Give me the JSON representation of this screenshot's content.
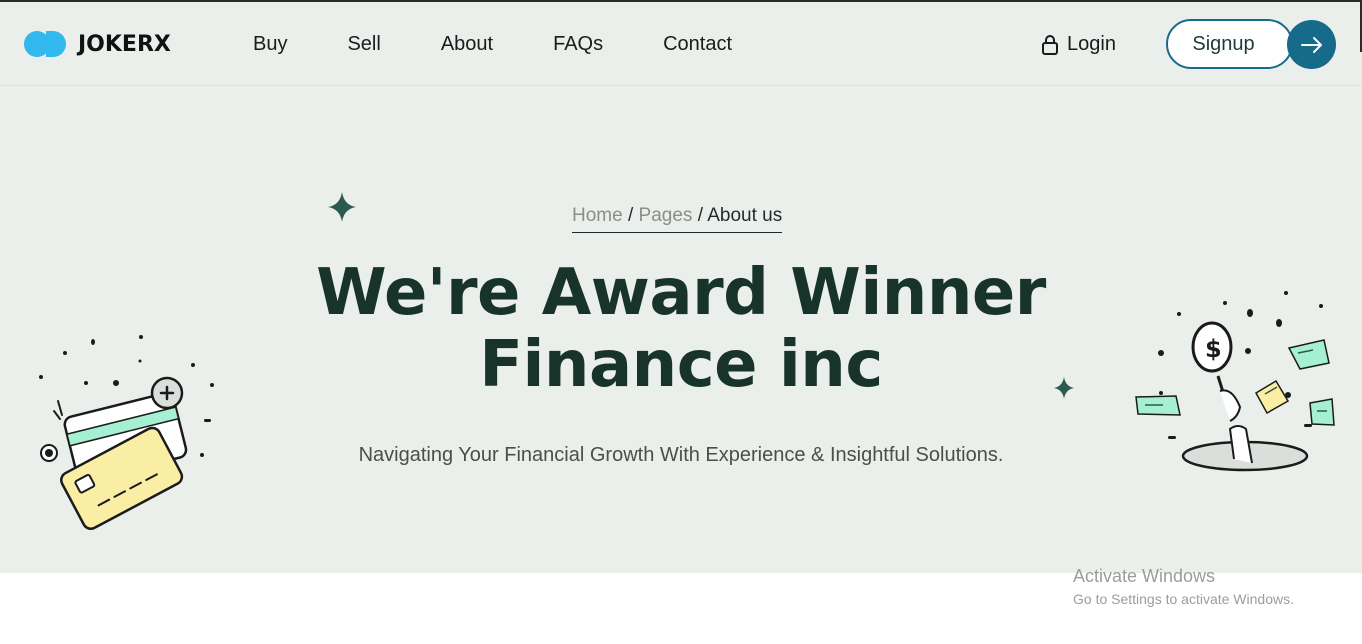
{
  "brand": {
    "name": "JOKERX",
    "accent": "#31b8ec",
    "primary": "#166a8a",
    "heading_color": "#17332a"
  },
  "nav": {
    "items": [
      "Buy",
      "Sell",
      "About",
      "FAQs",
      "Contact"
    ]
  },
  "header": {
    "login_label": "Login",
    "signup_label": "Signup",
    "lock_icon": "lock-icon",
    "arrow_icon": "arrow-right-icon"
  },
  "breadcrumb": {
    "home": "Home",
    "pages": "Pages",
    "current": "About us",
    "separator": "/"
  },
  "hero": {
    "title_line1": "We're Award Winner",
    "title_line2": "Finance inc",
    "subtitle": "Navigating Your Financial Growth With Experience & Insightful Solutions."
  },
  "watermark": {
    "line1": "Activate Windows",
    "line2": "Go to Settings to activate Windows."
  }
}
